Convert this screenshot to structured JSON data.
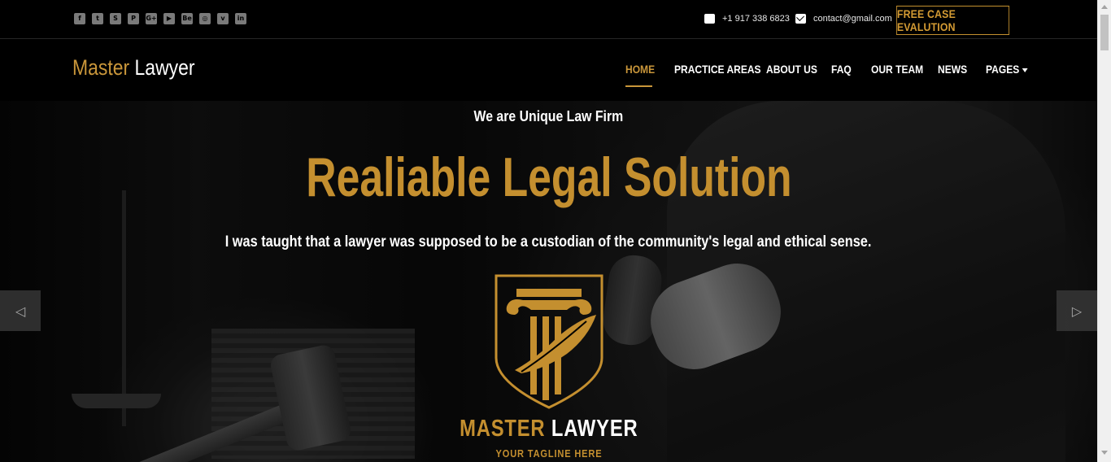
{
  "topbar": {
    "socials": [
      {
        "icon": "facebook-icon",
        "glyph": "f"
      },
      {
        "icon": "twitter-icon",
        "glyph": "t"
      },
      {
        "icon": "skype-icon",
        "glyph": "S"
      },
      {
        "icon": "pinterest-icon",
        "glyph": "P"
      },
      {
        "icon": "google-plus-icon",
        "glyph": "G+"
      },
      {
        "icon": "youtube-icon",
        "glyph": "▶"
      },
      {
        "icon": "behance-icon",
        "glyph": "Be"
      },
      {
        "icon": "dribbble-icon",
        "glyph": "◎"
      },
      {
        "icon": "vimeo-icon",
        "glyph": "v"
      },
      {
        "icon": "linkedin-icon",
        "glyph": "in"
      }
    ],
    "phone": "+1 917 338 6823",
    "email": "contact@gmail.com",
    "cta_label": "FREE CASE EVALUTION"
  },
  "brand": {
    "part1": "Master",
    "part2": "Lawyer"
  },
  "nav": {
    "items": [
      {
        "label": "HOME",
        "active": true
      },
      {
        "label": "PRACTICE AREAS",
        "active": false
      },
      {
        "label": "ABOUT US",
        "active": false
      },
      {
        "label": "FAQ",
        "active": false
      },
      {
        "label": "OUR TEAM",
        "active": false
      },
      {
        "label": "NEWS",
        "active": false
      },
      {
        "label": "PAGES",
        "active": false
      }
    ]
  },
  "hero": {
    "kicker": "We are Unique Law Firm",
    "headline": "Realiable Legal Solution",
    "subtitle": "I was taught that a lawyer was supposed to be a custodian of the community's legal and ethical sense.",
    "logo_word1": "MASTER",
    "logo_word2": "LAWYER",
    "tagline": "YOUR TAGLINE HERE"
  },
  "slider": {
    "prev_icon": "◁",
    "next_icon": "▷"
  },
  "colors": {
    "accent": "#c48f2f",
    "background": "#000000",
    "text": "#ffffff"
  }
}
